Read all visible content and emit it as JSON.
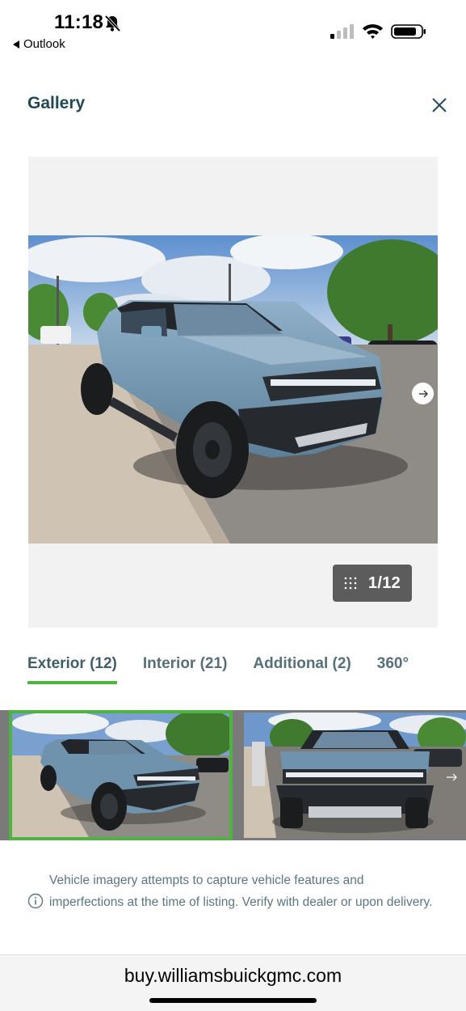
{
  "status_bar": {
    "time": "11:18",
    "back_app": "Outlook",
    "icons": [
      "bell-slash-icon",
      "signal-icon",
      "wifi-icon",
      "battery-icon"
    ]
  },
  "header": {
    "title": "Gallery",
    "close_icon": "close-icon"
  },
  "viewer": {
    "counter": "1/12",
    "counter_icon": "grid-dots-icon",
    "next_icon": "arrow-right-icon"
  },
  "tabs": [
    {
      "label": "Exterior (12)",
      "active": true
    },
    {
      "label": "Interior (21)",
      "active": false
    },
    {
      "label": "Additional (2)",
      "active": false
    },
    {
      "label": "360°",
      "active": false
    }
  ],
  "thumbnails": [
    {
      "view": "front-three-quarter",
      "selected": true
    },
    {
      "view": "front",
      "selected": false
    }
  ],
  "disclaimer": {
    "icon": "info-icon",
    "text": "Vehicle imagery attempts to capture vehicle features and imperfections at the time of listing. Verify with dealer or upon delivery."
  },
  "browser": {
    "url": "buy.williamsbuickgmc.com"
  },
  "colors": {
    "accent_green": "#4fb33f",
    "title_teal": "#1f4a55",
    "tab_text": "#56707a",
    "vehicle_blue": "#6f93ad"
  }
}
